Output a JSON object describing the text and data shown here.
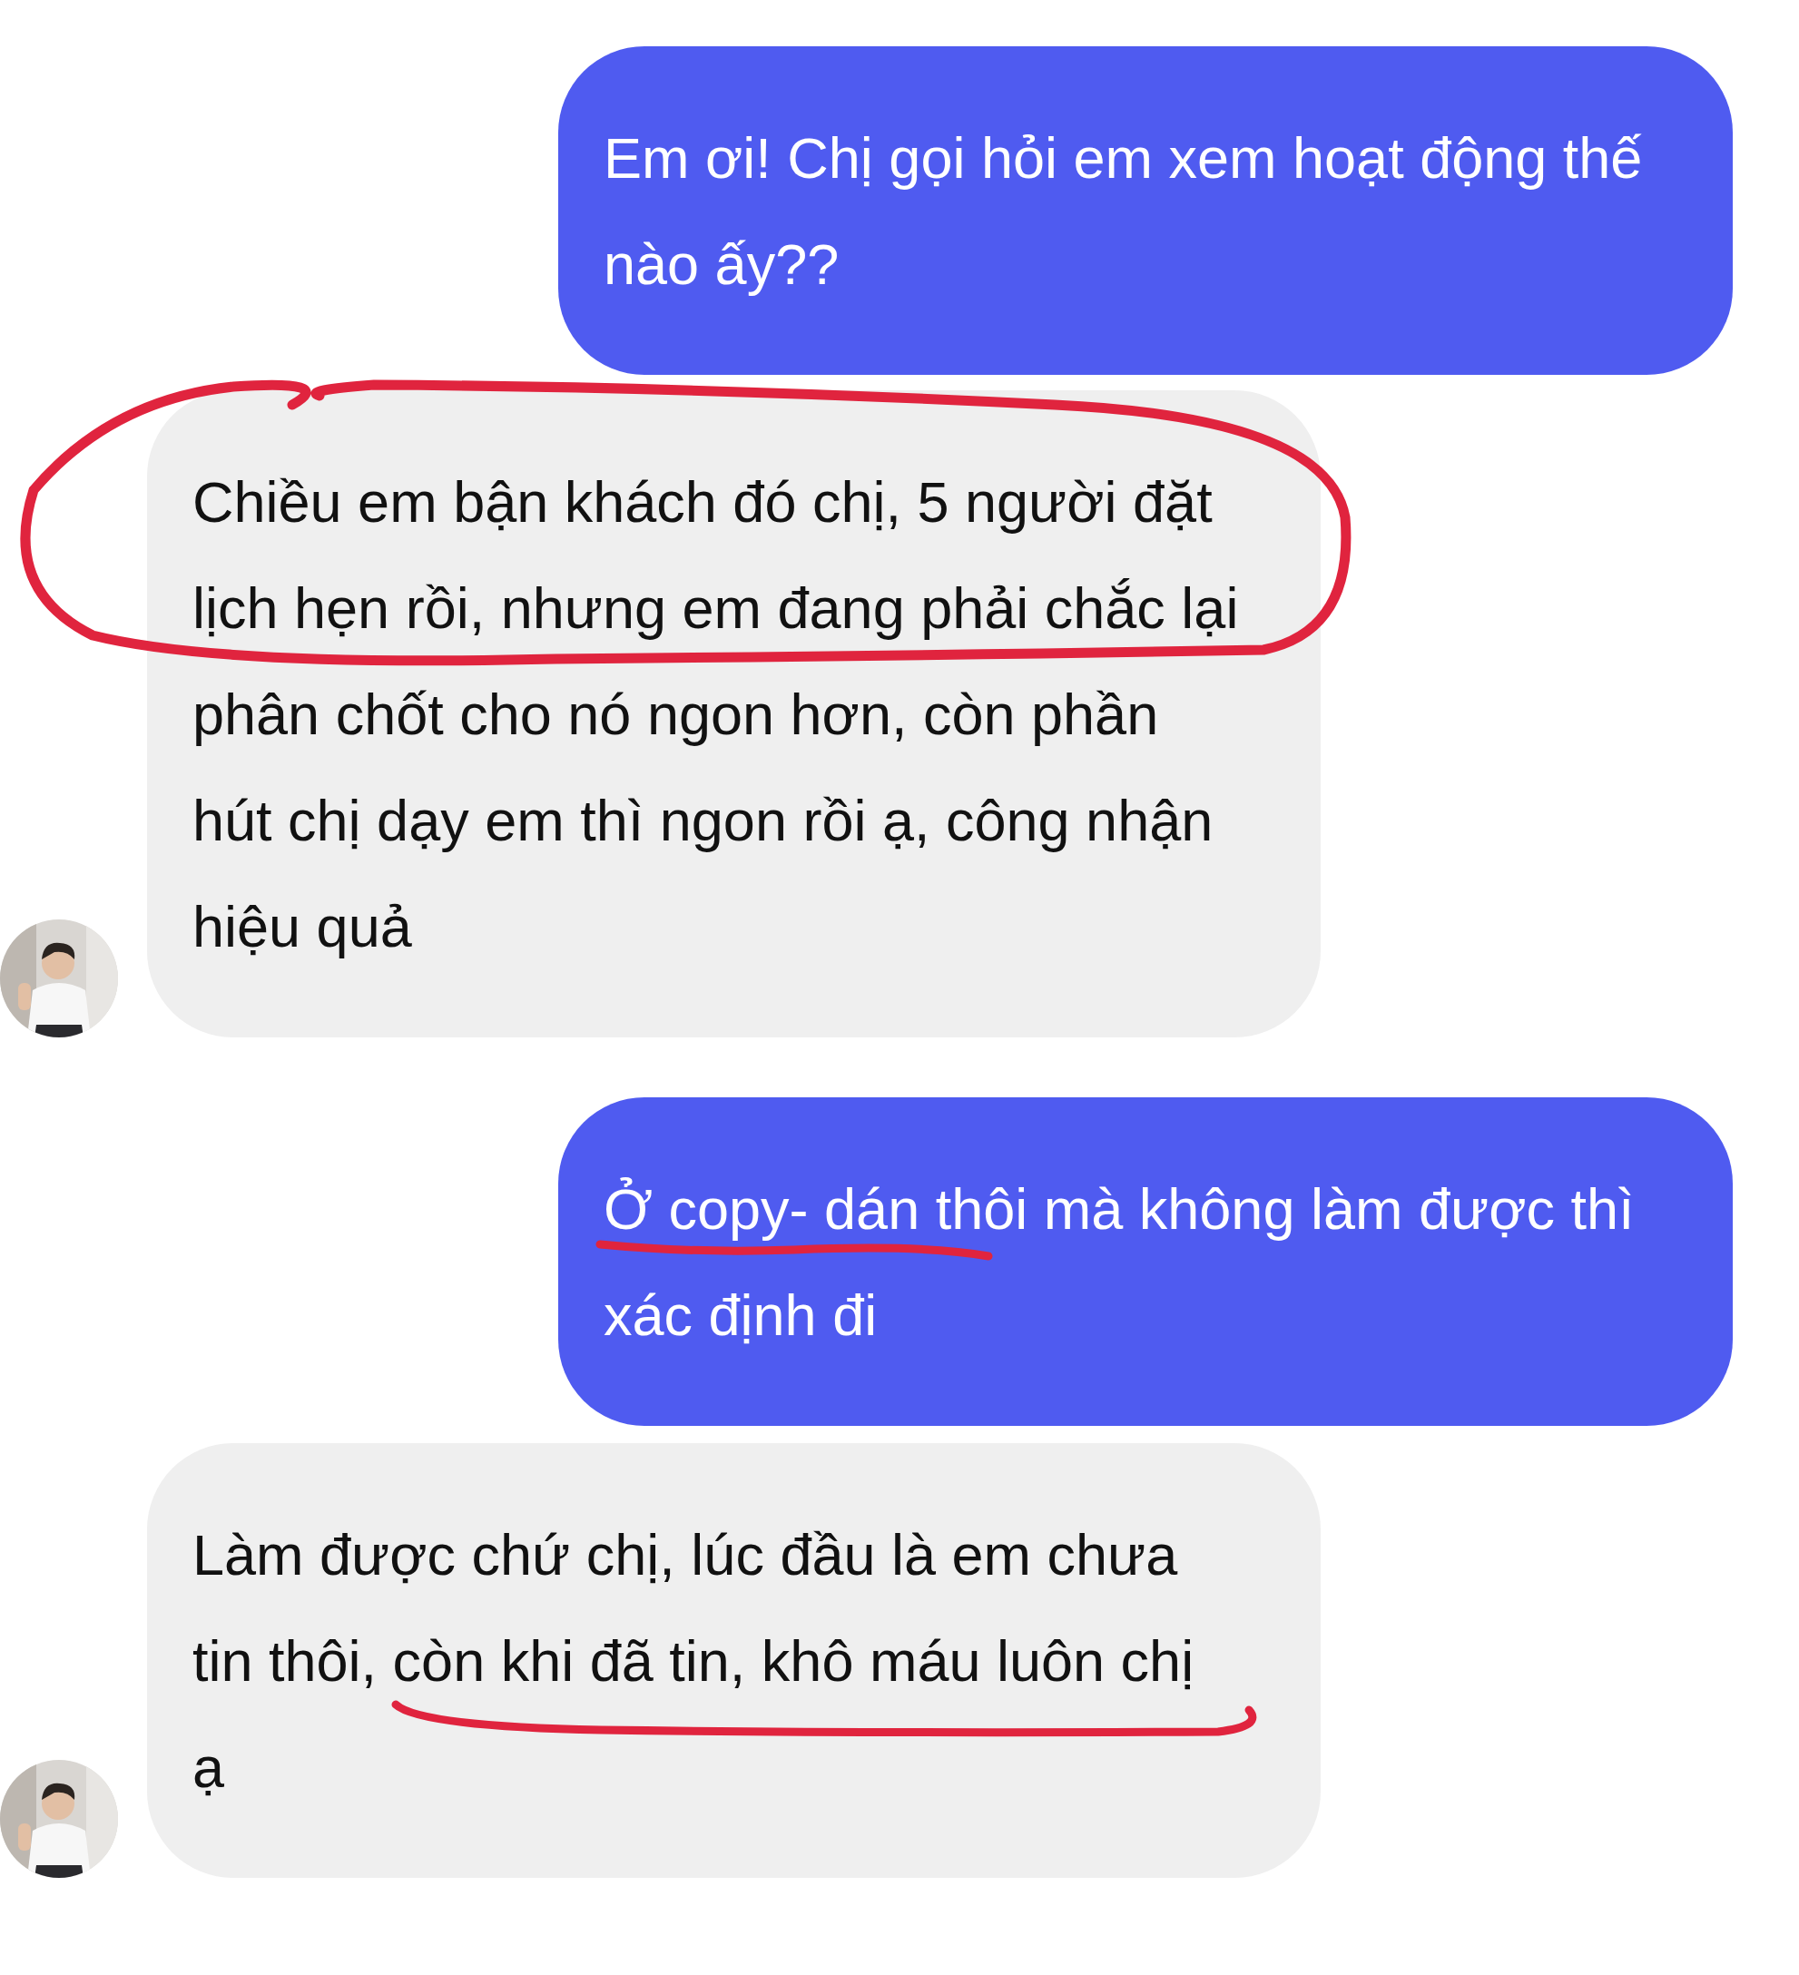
{
  "messages": [
    {
      "kind": "sent",
      "text": "Em ơi! Chị gọi hỏi em xem hoạt động thế\nnào ấy??",
      "circled": false,
      "underlined": false
    },
    {
      "kind": "received",
      "text": "Chiều em bận khách đó chị, 5 người đặt\nlịch hẹn rồi, nhưng em đang phải chắc lại\nphân chốt cho nó ngon hơn, còn phần\nhút chị dạy em thì ngon rồi ạ, công nhận\nhiệu quả",
      "circled": true,
      "underlined": false
    },
    {
      "kind": "sent",
      "text": "Ở copy- dán thôi mà không làm được thì\nxác định đi",
      "circled": false,
      "underlined": true
    },
    {
      "kind": "received",
      "text": "Làm được chứ chị, lúc đầu là em chưa\ntin thôi, còn khi đã tin, khô máu luôn chị\nạ",
      "circled": false,
      "underlined": true
    }
  ]
}
